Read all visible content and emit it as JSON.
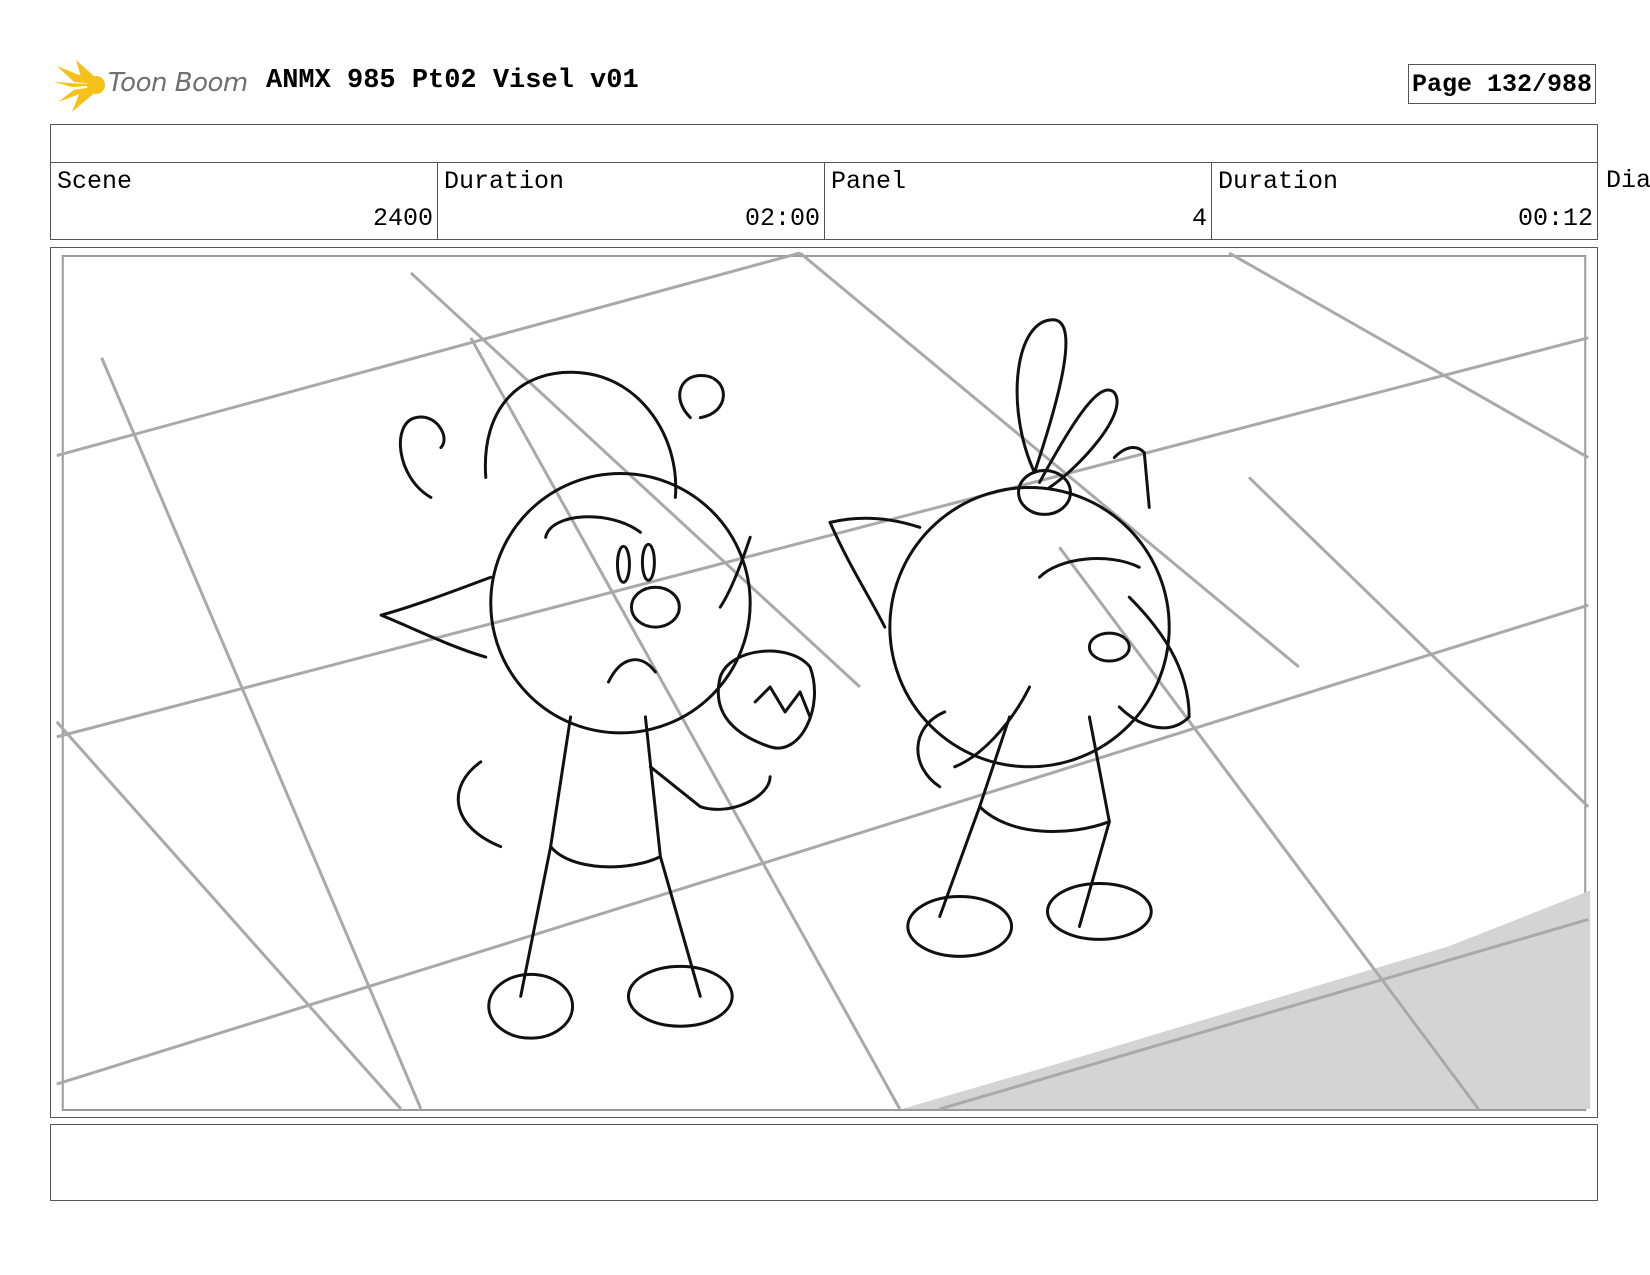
{
  "header": {
    "logo_text": "Toon Boom",
    "doc_title": "ANMX 985 Pt02 Visel v01",
    "page_label": "Page 132/988"
  },
  "info": {
    "scene_label": "Scene",
    "scene_value": "2400",
    "scene_duration_label": "Duration",
    "scene_duration_value": "02:00",
    "panel_label": "Panel",
    "panel_value": "4",
    "panel_duration_label": "Duration",
    "panel_duration_value": "00:12",
    "dialog_label": "Dia"
  },
  "colors": {
    "logo_burst": "#f6c21a",
    "logo_text": "#6f6f6f",
    "floor_lines": "#a9a9a9",
    "shadow": "#d4d4d4"
  },
  "notes": {
    "text": ""
  }
}
